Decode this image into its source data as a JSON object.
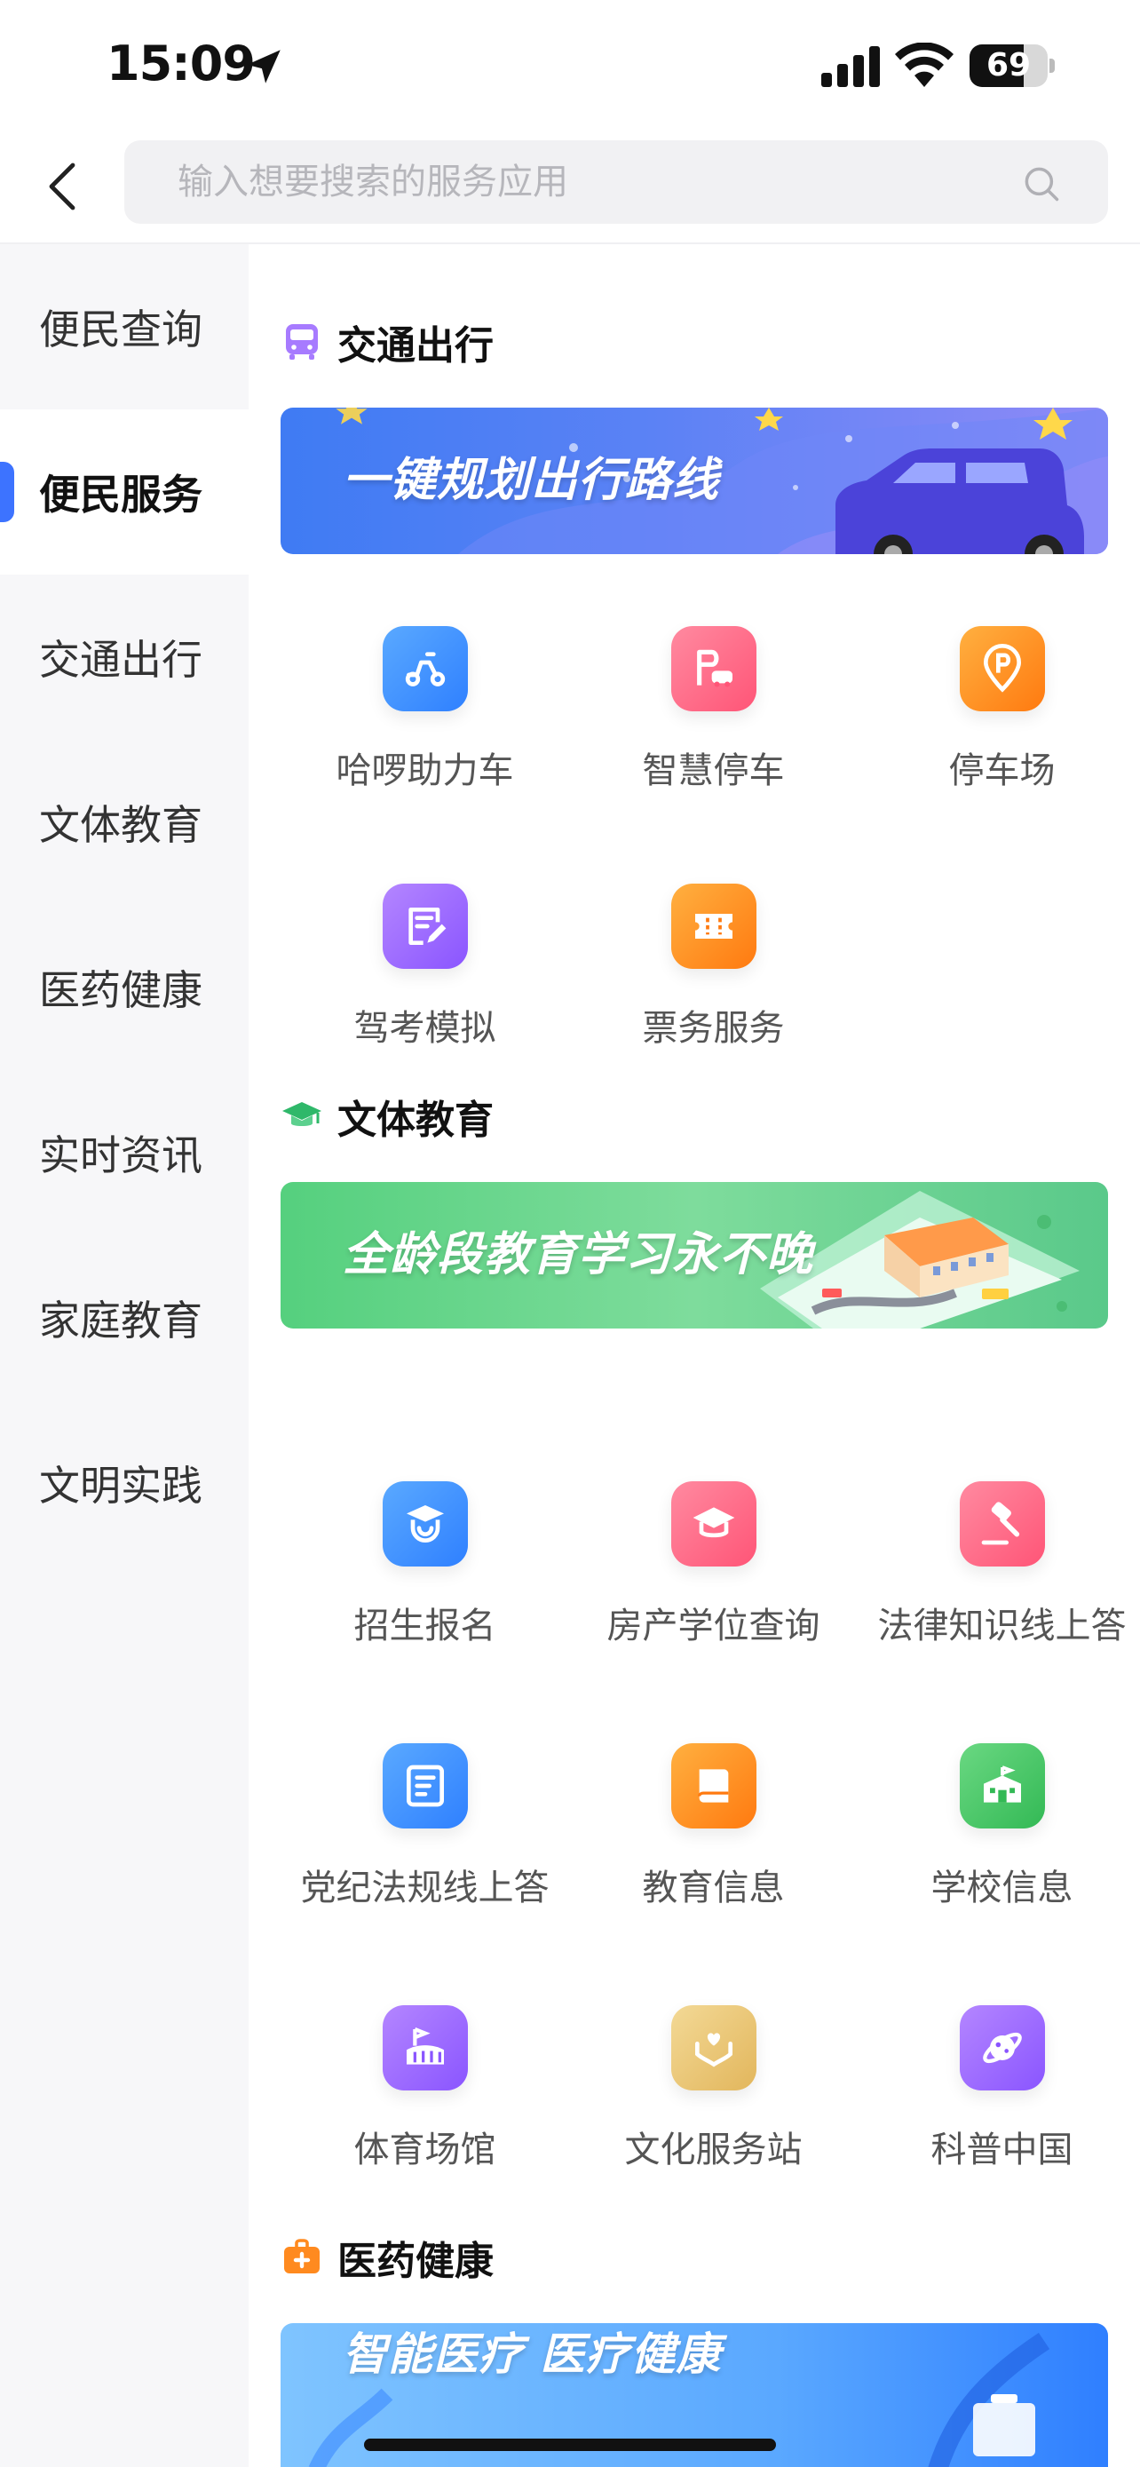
{
  "status_bar": {
    "time": "15:09",
    "battery": "69",
    "battery_level": 0.69
  },
  "header": {
    "search_placeholder": "输入想要搜索的服务应用"
  },
  "sidebar": {
    "items": [
      {
        "label": "便民查询"
      },
      {
        "label": "便民服务",
        "active": true
      },
      {
        "label": "交通出行"
      },
      {
        "label": "文体教育"
      },
      {
        "label": "医药健康"
      },
      {
        "label": "实时资讯"
      },
      {
        "label": "家庭教育"
      },
      {
        "label": "文明实践"
      }
    ]
  },
  "sections": [
    {
      "title": "交通出行",
      "icon": "bus-icon",
      "banner": "一键规划出行路线",
      "items": [
        {
          "label": "哈啰助力车",
          "icon": "scooter-icon",
          "color": "#3a8dff"
        },
        {
          "label": "智慧停车",
          "icon": "parking-car-icon",
          "color": "#ff5f7a"
        },
        {
          "label": "停车场",
          "icon": "parking-lot-icon",
          "color": "#ff8a1f"
        },
        {
          "label": "驾考模拟",
          "icon": "edit-note-icon",
          "color": "#9a62ff"
        },
        {
          "label": "票务服务",
          "icon": "ticket-icon",
          "color": "#ff8a1f"
        }
      ]
    },
    {
      "title": "文体教育",
      "icon": "graduation-cap-icon",
      "banner": "全龄段教育学习永不晚",
      "items": [
        {
          "label": "招生报名",
          "icon": "student-icon",
          "color": "#3a8dff"
        },
        {
          "label": "房产学位查询",
          "icon": "degree-cap-icon",
          "color": "#ff5f7a"
        },
        {
          "label": "法律知识线上答",
          "icon": "gavel-icon",
          "color": "#ff5f7a"
        },
        {
          "label": "党纪法规线上答",
          "icon": "answer-icon",
          "color": "#3a8dff"
        },
        {
          "label": "教育信息",
          "icon": "book-icon",
          "color": "#ff8a1f"
        },
        {
          "label": "学校信息",
          "icon": "school-icon",
          "color": "#3dc15a"
        },
        {
          "label": "体育场馆",
          "icon": "stadium-icon",
          "color": "#9a62ff"
        },
        {
          "label": "文化服务站",
          "icon": "heart-hands-icon",
          "color": "#e6c070"
        },
        {
          "label": "科普中国",
          "icon": "planet-icon",
          "color": "#9a62ff"
        }
      ]
    },
    {
      "title": "医药健康",
      "icon": "medical-kit-icon",
      "banner": "智能医疗 医疗健康"
    }
  ]
}
